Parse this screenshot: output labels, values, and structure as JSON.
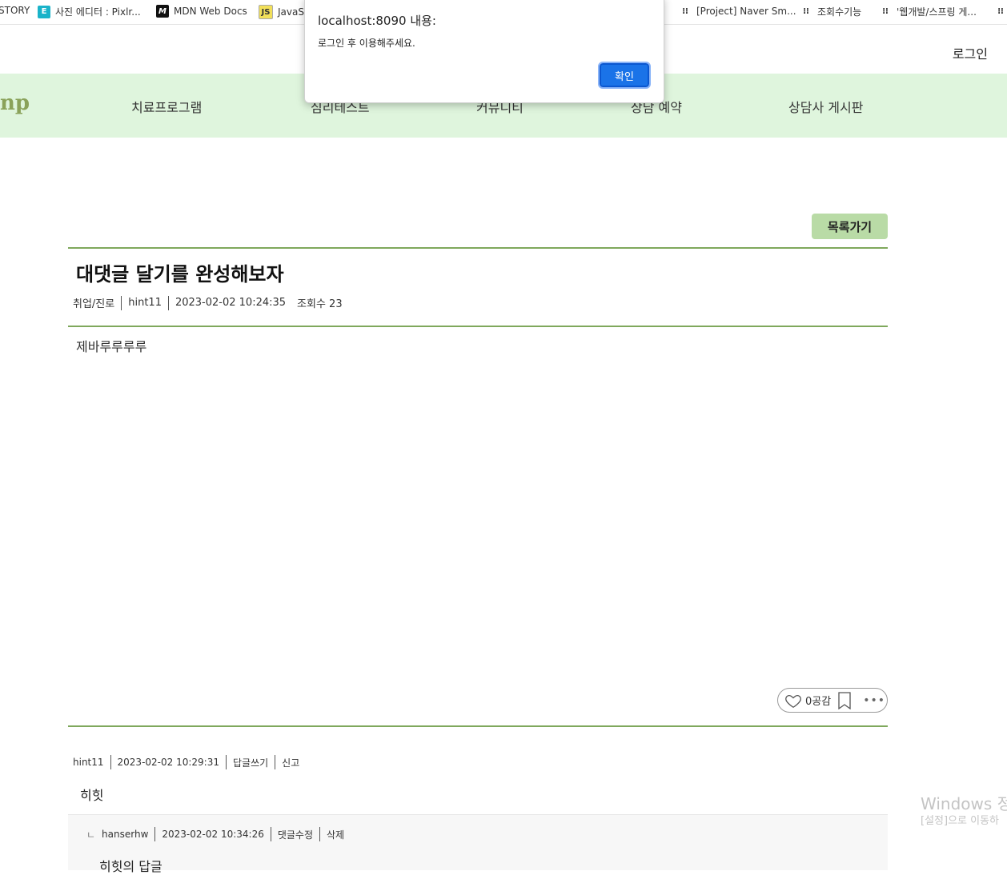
{
  "bookmarks": [
    {
      "label": "STORY",
      "icon": "none"
    },
    {
      "label": "사진 에디터 : Pixlr...",
      "icon": "pixlr-icon"
    },
    {
      "label": "MDN Web Docs",
      "icon": "mdn-icon"
    },
    {
      "label": "JavaSc",
      "icon": "javascript-icon"
    },
    {
      "label": "[Project] Naver Sm...",
      "icon": "tistory-icon"
    },
    {
      "label": "조회수기능",
      "icon": "tistory-icon"
    },
    {
      "label": "'웹개발/스프링 게...",
      "icon": "tistory-icon"
    }
  ],
  "header": {
    "login_label": "로그인",
    "logo_text": "np",
    "nav": [
      "치료프로그램",
      "심리테스트",
      "커뮤니티",
      "상담 예약",
      "상담사 게시판"
    ]
  },
  "post": {
    "list_button": "목록가기",
    "title": "대댓글 달기를 완성해보자",
    "category": "취업/진로",
    "author": "hint11",
    "date": "2023-02-02 10:24:35",
    "views": "조회수 23",
    "body": "제바루루루루",
    "likes": "0공감"
  },
  "comments": [
    {
      "author": "hint11",
      "date": "2023-02-02 10:29:31",
      "actions": [
        "답글쓰기",
        "신고"
      ],
      "text": "히힛",
      "replies": [
        {
          "prefix": "ㄴ",
          "author": "hanserhw",
          "date": "2023-02-02 10:34:26",
          "actions": [
            "댓글수정",
            "삭제"
          ],
          "text": "히힛의 답글"
        }
      ]
    }
  ],
  "watermark": {
    "line1": "Windows 정",
    "line2": "[설정]으로 이동하"
  },
  "dialog": {
    "title": "localhost:8090 내용:",
    "message": "로그인 후 이용해주세요.",
    "ok_label": "확인"
  },
  "colors": {
    "nav_bg": "#dff5dd",
    "accent_rule": "#7fa85c",
    "list_button_bg": "#b9dba6",
    "logo": "#8aa25a",
    "dialog_button": "#1a73e8"
  }
}
